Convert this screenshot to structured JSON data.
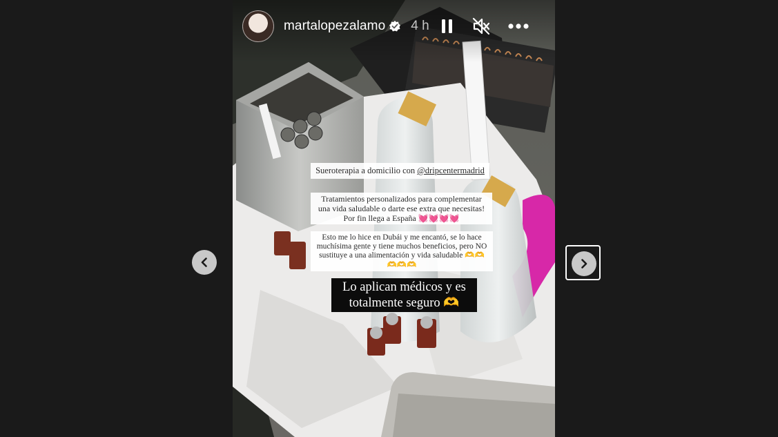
{
  "story": {
    "username": "martalopezalamo",
    "verified": true,
    "time_ago": "4 h",
    "controls": {
      "pause_icon": "pause-icon",
      "mute_icon": "speaker-muted-icon",
      "more_icon": "more-options-icon"
    },
    "captions": {
      "line1_prefix": "Sueroterapia a domicilio con ",
      "line1_mention": "@dripcentermadrid",
      "block2": "Tratamientos personalizados para complementar una vida saludable o darte ese extra que necesitas! Por fin llega a España 💓💓💓💓",
      "block3": "Esto me lo hice en Dubái y me encantó, se lo hace muchísima gente y tiene muchos beneficios, pero NO sustituye a una alimentación y vida saludable 🫶🫶🫶🫶🫶",
      "highlight": "Lo aplican médicos y es totalmente seguro 🫶"
    }
  },
  "navigation": {
    "prev_icon": "chevron-left-icon",
    "next_icon": "chevron-right-icon"
  },
  "colors": {
    "page_background": "#1a1a1a",
    "nav_button": "#c8c8c8",
    "highlight_background": "#0c0c0c"
  }
}
